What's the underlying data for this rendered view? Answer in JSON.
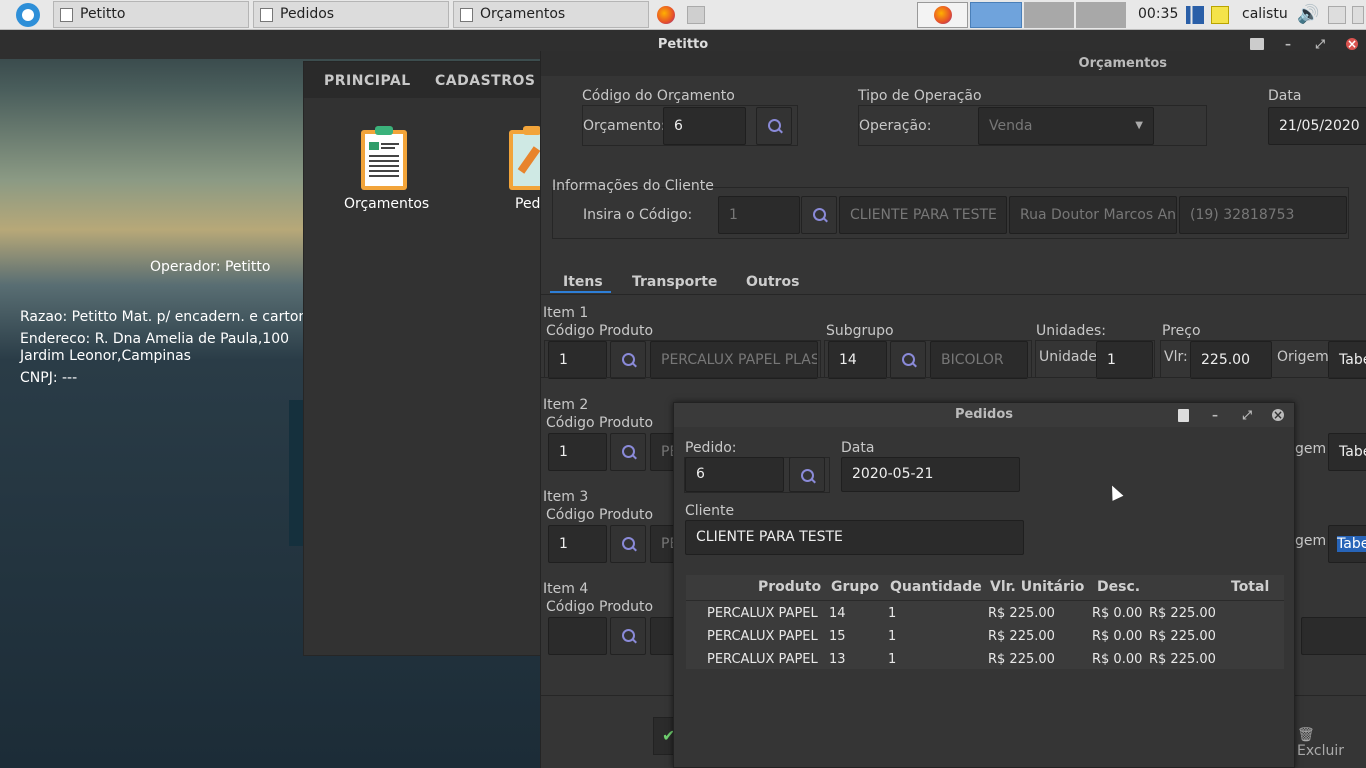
{
  "taskbar": {
    "tasks": [
      {
        "label": "Petitto"
      },
      {
        "label": "Pedidos"
      },
      {
        "label": "Orçamentos"
      }
    ],
    "clock": "00:35",
    "user": "calistu"
  },
  "main_window": {
    "title": "Petitto",
    "operator": "Operador: Petitto",
    "razao": "Razao: Petitto Mat. p/ encadern. e carton.",
    "endereco_line1": "Endereco: R. Dna Amelia de Paula,100",
    "endereco_line2": "Jardim Leonor,Campinas",
    "cnpj": "CNPJ: ---",
    "menu_tabs": [
      "PRINCIPAL",
      "CADASTROS"
    ],
    "apps": [
      {
        "label": "Orçamentos",
        "icon": "clipboard-list-icon"
      },
      {
        "label": "Ped",
        "icon": "clipboard-edit-icon"
      }
    ]
  },
  "orcamentos": {
    "title": "Orçamentos",
    "codigo_group": "Código do Orçamento",
    "orcamento_label": "Orçamento:",
    "orcamento_value": "6",
    "tipo_group": "Tipo de Operação",
    "operacao_label": "Operação:",
    "operacao_value": "Venda",
    "data_group": "Data",
    "data_value": "21/05/2020",
    "cliente_group": "Informações do Cliente",
    "insira_label": "Insira o Código:",
    "cliente_codigo": "1",
    "cliente_nome": "CLIENTE PARA TESTE",
    "cliente_endereco": "Rua Doutor Marcos Ant",
    "cliente_telefone": "(19) 32818753",
    "tabs": [
      "Itens",
      "Transporte",
      "Outros"
    ],
    "item1": {
      "title": "Item 1",
      "codigo_label": "Código Produto",
      "codigo": "1",
      "produto": "PERCALUX PAPEL PLAST",
      "subgrupo_label": "Subgrupo",
      "subgrupo": "14",
      "subgrupo_nome": "BICOLOR",
      "unidades_label": "Unidades:",
      "unidade_label": "Unidade",
      "unidade": "1",
      "preco_label": "Preço",
      "vlr_label": "Vlr:",
      "vlr": "225.00",
      "origem_label": "Origem",
      "origem": "Tabe"
    },
    "item2": {
      "title": "Item 2",
      "codigo_label": "Código Produto",
      "codigo": "1",
      "produto": "PE",
      "origem_label": "gem",
      "origem": "Tabe"
    },
    "item3": {
      "title": "Item 3",
      "codigo_label": "Código Produto",
      "codigo": "1",
      "produto": "PE",
      "origem_label": "gem",
      "origem": "Tabe"
    },
    "item4": {
      "title": "Item 4",
      "codigo_label": "Código Produto",
      "codigo": ""
    },
    "excluir_label": "Excluir"
  },
  "pedidos": {
    "title": "Pedidos",
    "pedido_label": "Pedido:",
    "pedido_value": "6",
    "data_label": "Data",
    "data_value": "2020-05-21",
    "cliente_label": "Cliente",
    "cliente_value": "CLIENTE PARA TESTE",
    "columns": [
      "Produto",
      "Grupo",
      "Quantidade",
      "Vlr. Unitário",
      "Desc.",
      "Total"
    ],
    "rows": [
      {
        "produto": "PERCALUX PAPEL",
        "grupo": "14",
        "quantidade": "1",
        "unitario": "R$ 225.00",
        "desc": "R$ 0.00",
        "total": "R$ 225.00"
      },
      {
        "produto": "PERCALUX PAPEL",
        "grupo": "15",
        "quantidade": "1",
        "unitario": "R$ 225.00",
        "desc": "R$ 0.00",
        "total": "R$ 225.00"
      },
      {
        "produto": "PERCALUX PAPEL",
        "grupo": "13",
        "quantidade": "1",
        "unitario": "R$ 225.00",
        "desc": "R$ 0.00",
        "total": "R$ 225.00"
      }
    ]
  },
  "colors": {
    "accent": "#2e7fd8",
    "window_bg": "#353535",
    "field_bg": "#2b2b2b",
    "selection": "#2764b8"
  }
}
